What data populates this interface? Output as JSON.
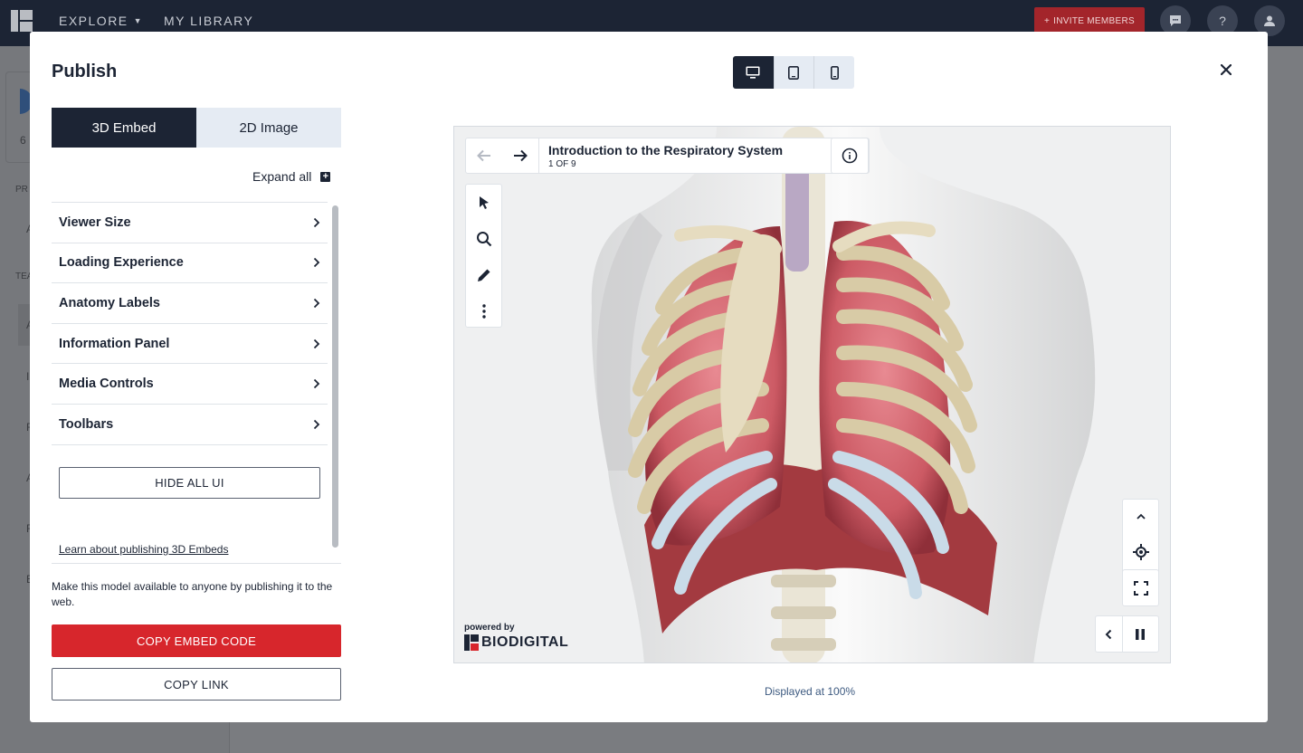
{
  "app": {
    "nav": {
      "explore": "EXPLORE",
      "library": "MY LIBRARY"
    },
    "invite_label": "INVITE MEMBERS",
    "icons": [
      "chat-icon",
      "help-icon",
      "user-icon"
    ],
    "help_glyph": "?",
    "background_text": {
      "count": "6",
      "row1": "PR",
      "row2": "A",
      "row3": "TEA",
      "row4": "A",
      "row5": "I",
      "row6": "F",
      "row7": "A",
      "row8": "F",
      "row9": "E"
    }
  },
  "modal": {
    "title": "Publish",
    "tabs": [
      {
        "label": "3D Embed",
        "active": true
      },
      {
        "label": "2D Image",
        "active": false
      }
    ],
    "expand_all": "Expand all",
    "accordion": [
      {
        "label": "Viewer Size"
      },
      {
        "label": "Loading Experience"
      },
      {
        "label": "Anatomy Labels"
      },
      {
        "label": "Information Panel"
      },
      {
        "label": "Media Controls"
      },
      {
        "label": "Toolbars"
      }
    ],
    "hide_all_ui": "HIDE ALL UI",
    "learn_link": "Learn about publishing 3D Embeds",
    "description": "Make this model available to anyone by publishing it to the web.",
    "copy_embed": "COPY EMBED CODE",
    "copy_link": "COPY LINK",
    "devices": [
      {
        "name": "desktop",
        "active": true
      },
      {
        "name": "tablet",
        "active": false
      },
      {
        "name": "phone",
        "active": false
      }
    ],
    "displayed_at": "Displayed at 100%"
  },
  "viewer": {
    "tour_title": "Introduction to the Respiratory System",
    "tour_step": "1 OF 9",
    "powered_by": "powered by",
    "brand": "BIODIGITAL"
  },
  "colors": {
    "navy": "#1c2434",
    "accent_red": "#d7262c",
    "tab_inactive": "#e5ebf3",
    "link_blue": "#3d5a80"
  }
}
